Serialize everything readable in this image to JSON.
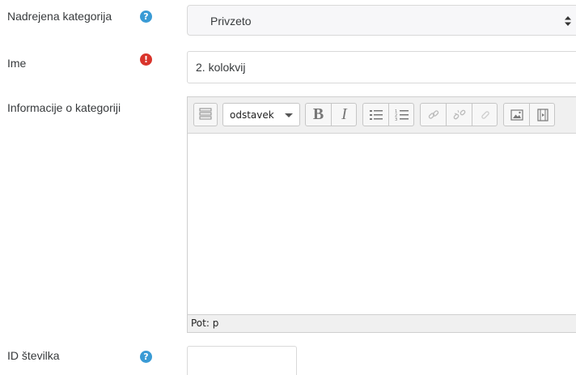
{
  "fields": {
    "parent_category": {
      "label": "Nadrejena kategorija",
      "value": "Privzeto",
      "help_icon": "question-circle-icon"
    },
    "name": {
      "label": "Ime",
      "value": "2. kolokvij",
      "required_icon": "exclamation-circle-icon"
    },
    "description": {
      "label": "Informacije o kategoriji",
      "toolbar": {
        "paragraph_format": "odstavek",
        "buttons": [
          "toolbar-toggle-icon",
          "bold-icon",
          "italic-icon",
          "unordered-list-icon",
          "ordered-list-icon",
          "link-icon",
          "unlink-icon",
          "link-disabled-icon",
          "image-icon",
          "media-icon"
        ]
      },
      "status_path": "Pot: p"
    },
    "id_number": {
      "label": "ID številka",
      "value": "",
      "help_icon": "question-circle-icon"
    }
  },
  "colors": {
    "help": "#3a9bd5",
    "required": "#d9342b",
    "border": "#d9d9d9",
    "toolbar_bg": "#f0f0f0"
  }
}
